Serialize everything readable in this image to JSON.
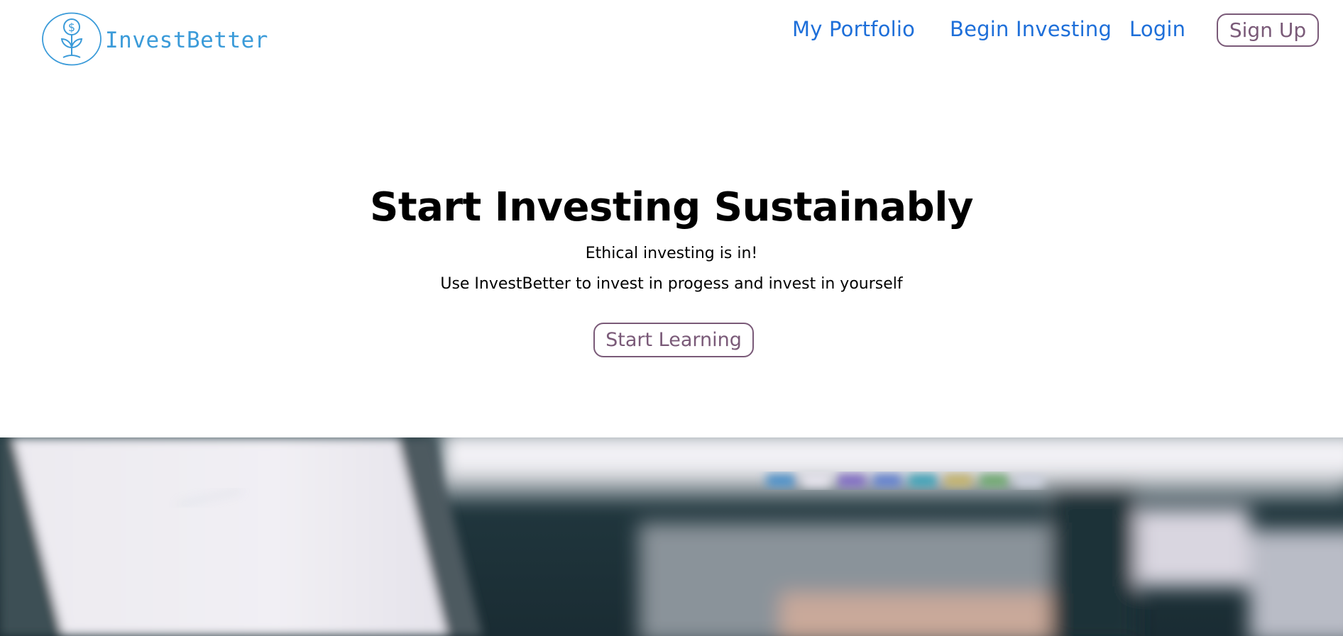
{
  "brand": {
    "name": "InvestBetter",
    "logo_icon": "dollar-sprout-icon",
    "color": "#3b9bd9"
  },
  "nav": {
    "items": [
      {
        "label": "My Portfolio"
      },
      {
        "label": "Begin Investing"
      },
      {
        "label": "Login"
      }
    ],
    "signup_label": "Sign Up",
    "link_color": "#1e6fd9",
    "button_color": "#7a5a78"
  },
  "hero": {
    "title": "Start Investing Sustainably",
    "line1": "Ethical investing is in!",
    "line2": "Use InvestBetter to invest in progess and invest in yourself",
    "cta_label": "Start Learning"
  },
  "banner": {
    "description_icon": "blurred-laptop-photo"
  }
}
